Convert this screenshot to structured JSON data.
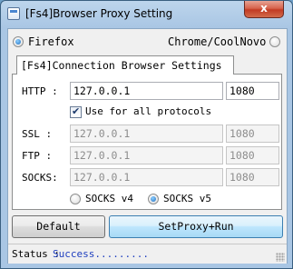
{
  "window": {
    "title": "[Fs4]Browser Proxy Setting",
    "close_glyph": "x"
  },
  "browser_choice": {
    "firefox_label": "Firefox",
    "chrome_label": "Chrome/CoolNovo",
    "selected": "Firefox"
  },
  "tab": {
    "label": "[Fs4]Connection Browser Settings"
  },
  "proxy": {
    "http": {
      "label": "HTTP  :",
      "host": "127.0.0.1",
      "port": "1080"
    },
    "use_for_all": {
      "label": "Use for all protocols",
      "checked": true,
      "check_glyph": "✔"
    },
    "ssl": {
      "label": "SSL   :",
      "host": "127.0.0.1",
      "port": "1080"
    },
    "ftp": {
      "label": "FTP   :",
      "host": "127.0.0.1",
      "port": "1080"
    },
    "socks": {
      "label": "SOCKS:",
      "host": "127.0.0.1",
      "port": "1080"
    }
  },
  "socks_version": {
    "v4_label": "SOCKS v4",
    "v5_label": "SOCKS v5",
    "selected": "SOCKS v5"
  },
  "buttons": {
    "default_label": "Default",
    "run_label": "SetProxy+Run"
  },
  "status": {
    "label": "Status :",
    "value": "Success.........",
    "value_color": "#1f3fbf"
  }
}
